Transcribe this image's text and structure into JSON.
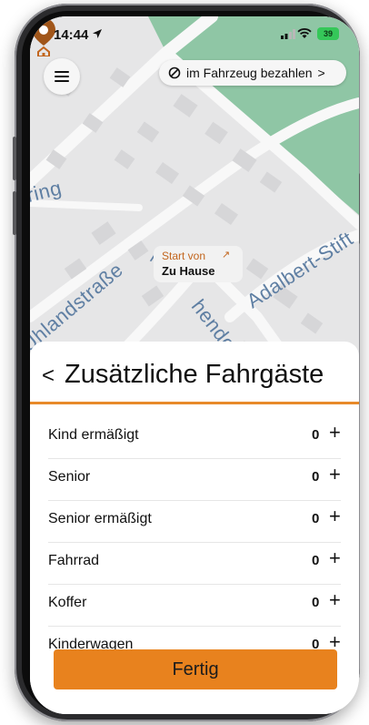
{
  "status_bar": {
    "time": "14:44",
    "battery": "39"
  },
  "header": {
    "pay_label": "im Fahrzeug bezahlen",
    "pay_chevron": ">"
  },
  "map": {
    "streets": [
      "ring",
      "Uhlandstraße",
      "Adalbert-Stift",
      "hendo"
    ],
    "start_label": "Start von",
    "start_arrow": "↗",
    "home_label": "Zu Hause"
  },
  "sheet": {
    "back_glyph": "<",
    "title": "Zusätzliche Fahrgäste",
    "rows": [
      {
        "label": "Kind ermäßigt",
        "count": "0",
        "plus": "+"
      },
      {
        "label": "Senior",
        "count": "0",
        "plus": "+"
      },
      {
        "label": "Senior ermäßigt",
        "count": "0",
        "plus": "+"
      },
      {
        "label": "Fahrrad",
        "count": "0",
        "plus": "+"
      },
      {
        "label": "Koffer",
        "count": "0",
        "plus": "+"
      },
      {
        "label": "Kinderwagen",
        "count": "0",
        "plus": "+"
      }
    ],
    "done_label": "Fertig"
  },
  "colors": {
    "accent": "#e8821e",
    "accent_text": "#c2651d",
    "map_green": "#8fc6a5",
    "street_label": "#5f7fa3"
  }
}
